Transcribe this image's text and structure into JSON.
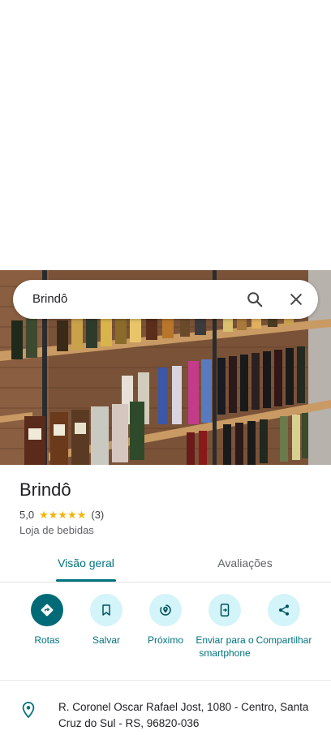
{
  "search": {
    "query": "Brindô"
  },
  "place": {
    "name": "Brindô",
    "rating": "5,0",
    "stars": [
      "★",
      "★",
      "★",
      "★",
      "★"
    ],
    "review_count": "(3)",
    "category": "Loja de bebidas",
    "address": "R. Coronel Oscar Rafael Jost, 1080 - Centro, Santa Cruz do Sul - RS, 96820-036"
  },
  "tabs": [
    {
      "label": "Visão geral",
      "active": true
    },
    {
      "label": "Avaliações",
      "active": false
    }
  ],
  "actions": [
    {
      "label": "Rotas",
      "icon": "directions-icon"
    },
    {
      "label": "Salvar",
      "icon": "bookmark-icon"
    },
    {
      "label": "Próximo",
      "icon": "nearby-icon"
    },
    {
      "label": "Enviar para o smartphone",
      "icon": "send-to-phone-icon"
    },
    {
      "label": "Compartilhar",
      "icon": "share-icon"
    }
  ],
  "colors": {
    "accent": "#00737c",
    "primary_action": "#006a77",
    "action_bg": "#d3f4f9",
    "star": "#f4b400"
  }
}
